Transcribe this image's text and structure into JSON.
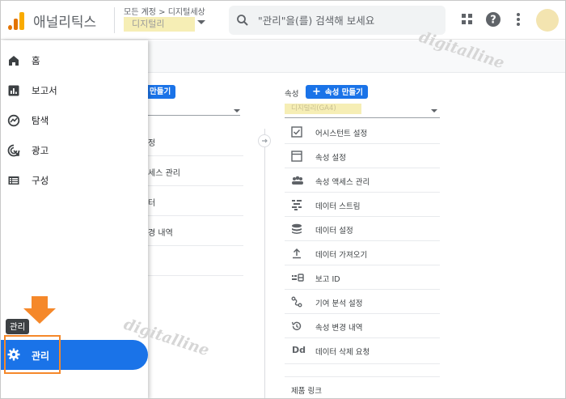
{
  "header": {
    "app_title": "애널리틱스",
    "account_path": "모든 계정 > 디지털세상",
    "account_name": "디지털리",
    "search_placeholder": "\"관리\"을(를) 검색해 보세요"
  },
  "sidebar": {
    "items": [
      {
        "label": "홈",
        "icon": "home-icon"
      },
      {
        "label": "보고서",
        "icon": "reports-icon"
      },
      {
        "label": "탐색",
        "icon": "explore-icon"
      },
      {
        "label": "광고",
        "icon": "advertising-icon"
      },
      {
        "label": "구성",
        "icon": "configure-icon"
      }
    ],
    "tooltip": "관리",
    "admin_label": "관리"
  },
  "account_column": {
    "create_button": "만들기",
    "items": [
      "정",
      "세스 관리",
      "터",
      "경 내역"
    ]
  },
  "property_column": {
    "label": "속성",
    "create_button": "속성 만들기",
    "property_name": "디지털리(GA4)",
    "items": [
      {
        "label": "어시스턴트 설정",
        "icon": "checklist-icon"
      },
      {
        "label": "속성 설정",
        "icon": "property-settings-icon"
      },
      {
        "label": "속성 액세스 관리",
        "icon": "people-icon"
      },
      {
        "label": "데이터 스트림",
        "icon": "data-streams-icon"
      },
      {
        "label": "데이터 설정",
        "icon": "database-icon"
      },
      {
        "label": "데이터 가져오기",
        "icon": "upload-icon"
      },
      {
        "label": "보고 ID",
        "icon": "reporting-id-icon"
      },
      {
        "label": "기여 분석 설정",
        "icon": "attribution-icon"
      },
      {
        "label": "속성 변경 내역",
        "icon": "history-icon"
      },
      {
        "label": "데이터 삭제 요청",
        "icon": "data-deletion-icon",
        "glyph": "Dd"
      }
    ],
    "product_links": "제품 링크"
  },
  "watermark": "digitalline",
  "colors": {
    "accent": "#1a73e8",
    "highlight": "#f5882a",
    "logo_orange": "#e37400",
    "logo_yellow": "#f9ab00"
  }
}
